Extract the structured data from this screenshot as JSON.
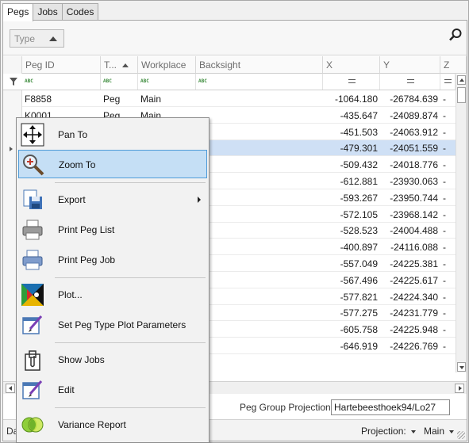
{
  "tabs": [
    {
      "label": "Pegs",
      "active": true
    },
    {
      "label": "Jobs",
      "active": false
    },
    {
      "label": "Codes",
      "active": false
    }
  ],
  "group_panel": {
    "chip_label": "Type"
  },
  "columns": [
    {
      "label": "Peg ID"
    },
    {
      "label": "T..."
    },
    {
      "label": "Workplace"
    },
    {
      "label": "Backsight"
    },
    {
      "label": "X"
    },
    {
      "label": "Y"
    },
    {
      "label": "Z"
    }
  ],
  "filter": {
    "text_glyph": "ABC",
    "num_glyph": "="
  },
  "rows": [
    {
      "peg_id": "F8858",
      "type": "Peg",
      "workplace": "Main",
      "x": "-1064.180",
      "y": "-26784.639",
      "z": "-"
    },
    {
      "peg_id": "K0001",
      "type": "Peg",
      "workplace": "Main",
      "x": "-435.647",
      "y": "-24089.874",
      "z": "-"
    },
    {
      "peg_id": "",
      "type": "",
      "workplace": "",
      "x": "-451.503",
      "y": "-24063.912",
      "z": "-"
    },
    {
      "peg_id": "",
      "type": "",
      "workplace": "",
      "x": "-479.301",
      "y": "-24051.559",
      "z": "-"
    },
    {
      "peg_id": "",
      "type": "",
      "workplace": "",
      "x": "-509.432",
      "y": "-24018.776",
      "z": "-"
    },
    {
      "peg_id": "",
      "type": "",
      "workplace": "",
      "x": "-612.881",
      "y": "-23930.063",
      "z": "-"
    },
    {
      "peg_id": "",
      "type": "",
      "workplace": "",
      "x": "-593.267",
      "y": "-23950.744",
      "z": "-"
    },
    {
      "peg_id": "",
      "type": "",
      "workplace": "",
      "x": "-572.105",
      "y": "-23968.142",
      "z": "-"
    },
    {
      "peg_id": "",
      "type": "",
      "workplace": "",
      "x": "-528.523",
      "y": "-24004.488",
      "z": "-"
    },
    {
      "peg_id": "",
      "type": "",
      "workplace": "",
      "x": "-400.897",
      "y": "-24116.088",
      "z": "-"
    },
    {
      "peg_id": "",
      "type": "",
      "workplace": "",
      "x": "-557.049",
      "y": "-24225.381",
      "z": "-"
    },
    {
      "peg_id": "",
      "type": "",
      "workplace": "",
      "x": "-567.496",
      "y": "-24225.617",
      "z": "-"
    },
    {
      "peg_id": "",
      "type": "",
      "workplace": "",
      "x": "-577.821",
      "y": "-24224.340",
      "z": "-"
    },
    {
      "peg_id": "",
      "type": "",
      "workplace": "",
      "x": "-577.275",
      "y": "-24231.779",
      "z": "-"
    },
    {
      "peg_id": "",
      "type": "",
      "workplace": "",
      "x": "-605.758",
      "y": "-24225.948",
      "z": "-"
    },
    {
      "peg_id": "",
      "type": "",
      "workplace": "",
      "x": "-646.919",
      "y": "-24226.769",
      "z": "-"
    }
  ],
  "selected_row_index": 3,
  "projection_row": {
    "label": "Peg Group Projection:",
    "value": "Hartebeesthoek94/Lo27"
  },
  "statusbar": {
    "left_text": "Dat",
    "projection_label": "Projection:",
    "main_label": "Main"
  },
  "context_menu": {
    "items": [
      {
        "label": "Pan To",
        "icon": "pan-icon"
      },
      {
        "label": "Zoom To",
        "icon": "zoom-icon",
        "highlighted": true
      },
      {
        "label": "Export",
        "icon": "export-icon",
        "submenu": true
      },
      {
        "label": "Print Peg List",
        "icon": "printer-icon"
      },
      {
        "label": "Print Peg Job",
        "icon": "printer-icon"
      },
      {
        "label": "Plot...",
        "icon": "plot-icon"
      },
      {
        "label": "Set Peg Type Plot Parameters",
        "icon": "edit-form-icon"
      },
      {
        "label": "Show Jobs",
        "icon": "clipboard-icon"
      },
      {
        "label": "Edit",
        "icon": "edit-form-icon"
      },
      {
        "label": "Variance Report",
        "icon": "venn-icon"
      }
    ]
  },
  "colors": {
    "selection": "#cfe0f5",
    "menu_highlight": "#c5dff5",
    "menu_highlight_border": "#4e9bd8"
  }
}
